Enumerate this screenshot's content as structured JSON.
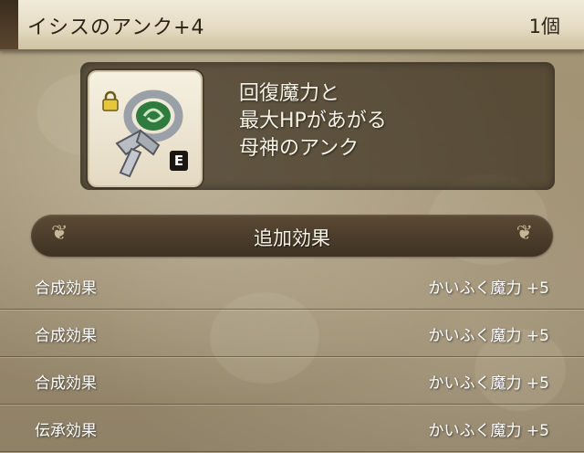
{
  "header": {
    "item_name": "イシスのアンク+4",
    "count": "1個"
  },
  "item": {
    "icon": "ankh-icon",
    "lock_icon": "lock-icon",
    "equipped_badge": "E",
    "description_lines": [
      "回復魔力と",
      "最大HPがあがる",
      "母神のアンク"
    ]
  },
  "effects_section": {
    "title": "追加効果",
    "rows": [
      {
        "label": "合成効果",
        "value": "かいふく魔力 +5"
      },
      {
        "label": "合成効果",
        "value": "かいふく魔力 +5"
      },
      {
        "label": "合成効果",
        "value": "かいふく魔力 +5"
      },
      {
        "label": "伝承効果",
        "value": "かいふく魔力 +5"
      }
    ]
  },
  "colors": {
    "header_bg": "#e6dcc4",
    "panel_bg": "#3c3020",
    "text_light": "#f7f2e6"
  }
}
